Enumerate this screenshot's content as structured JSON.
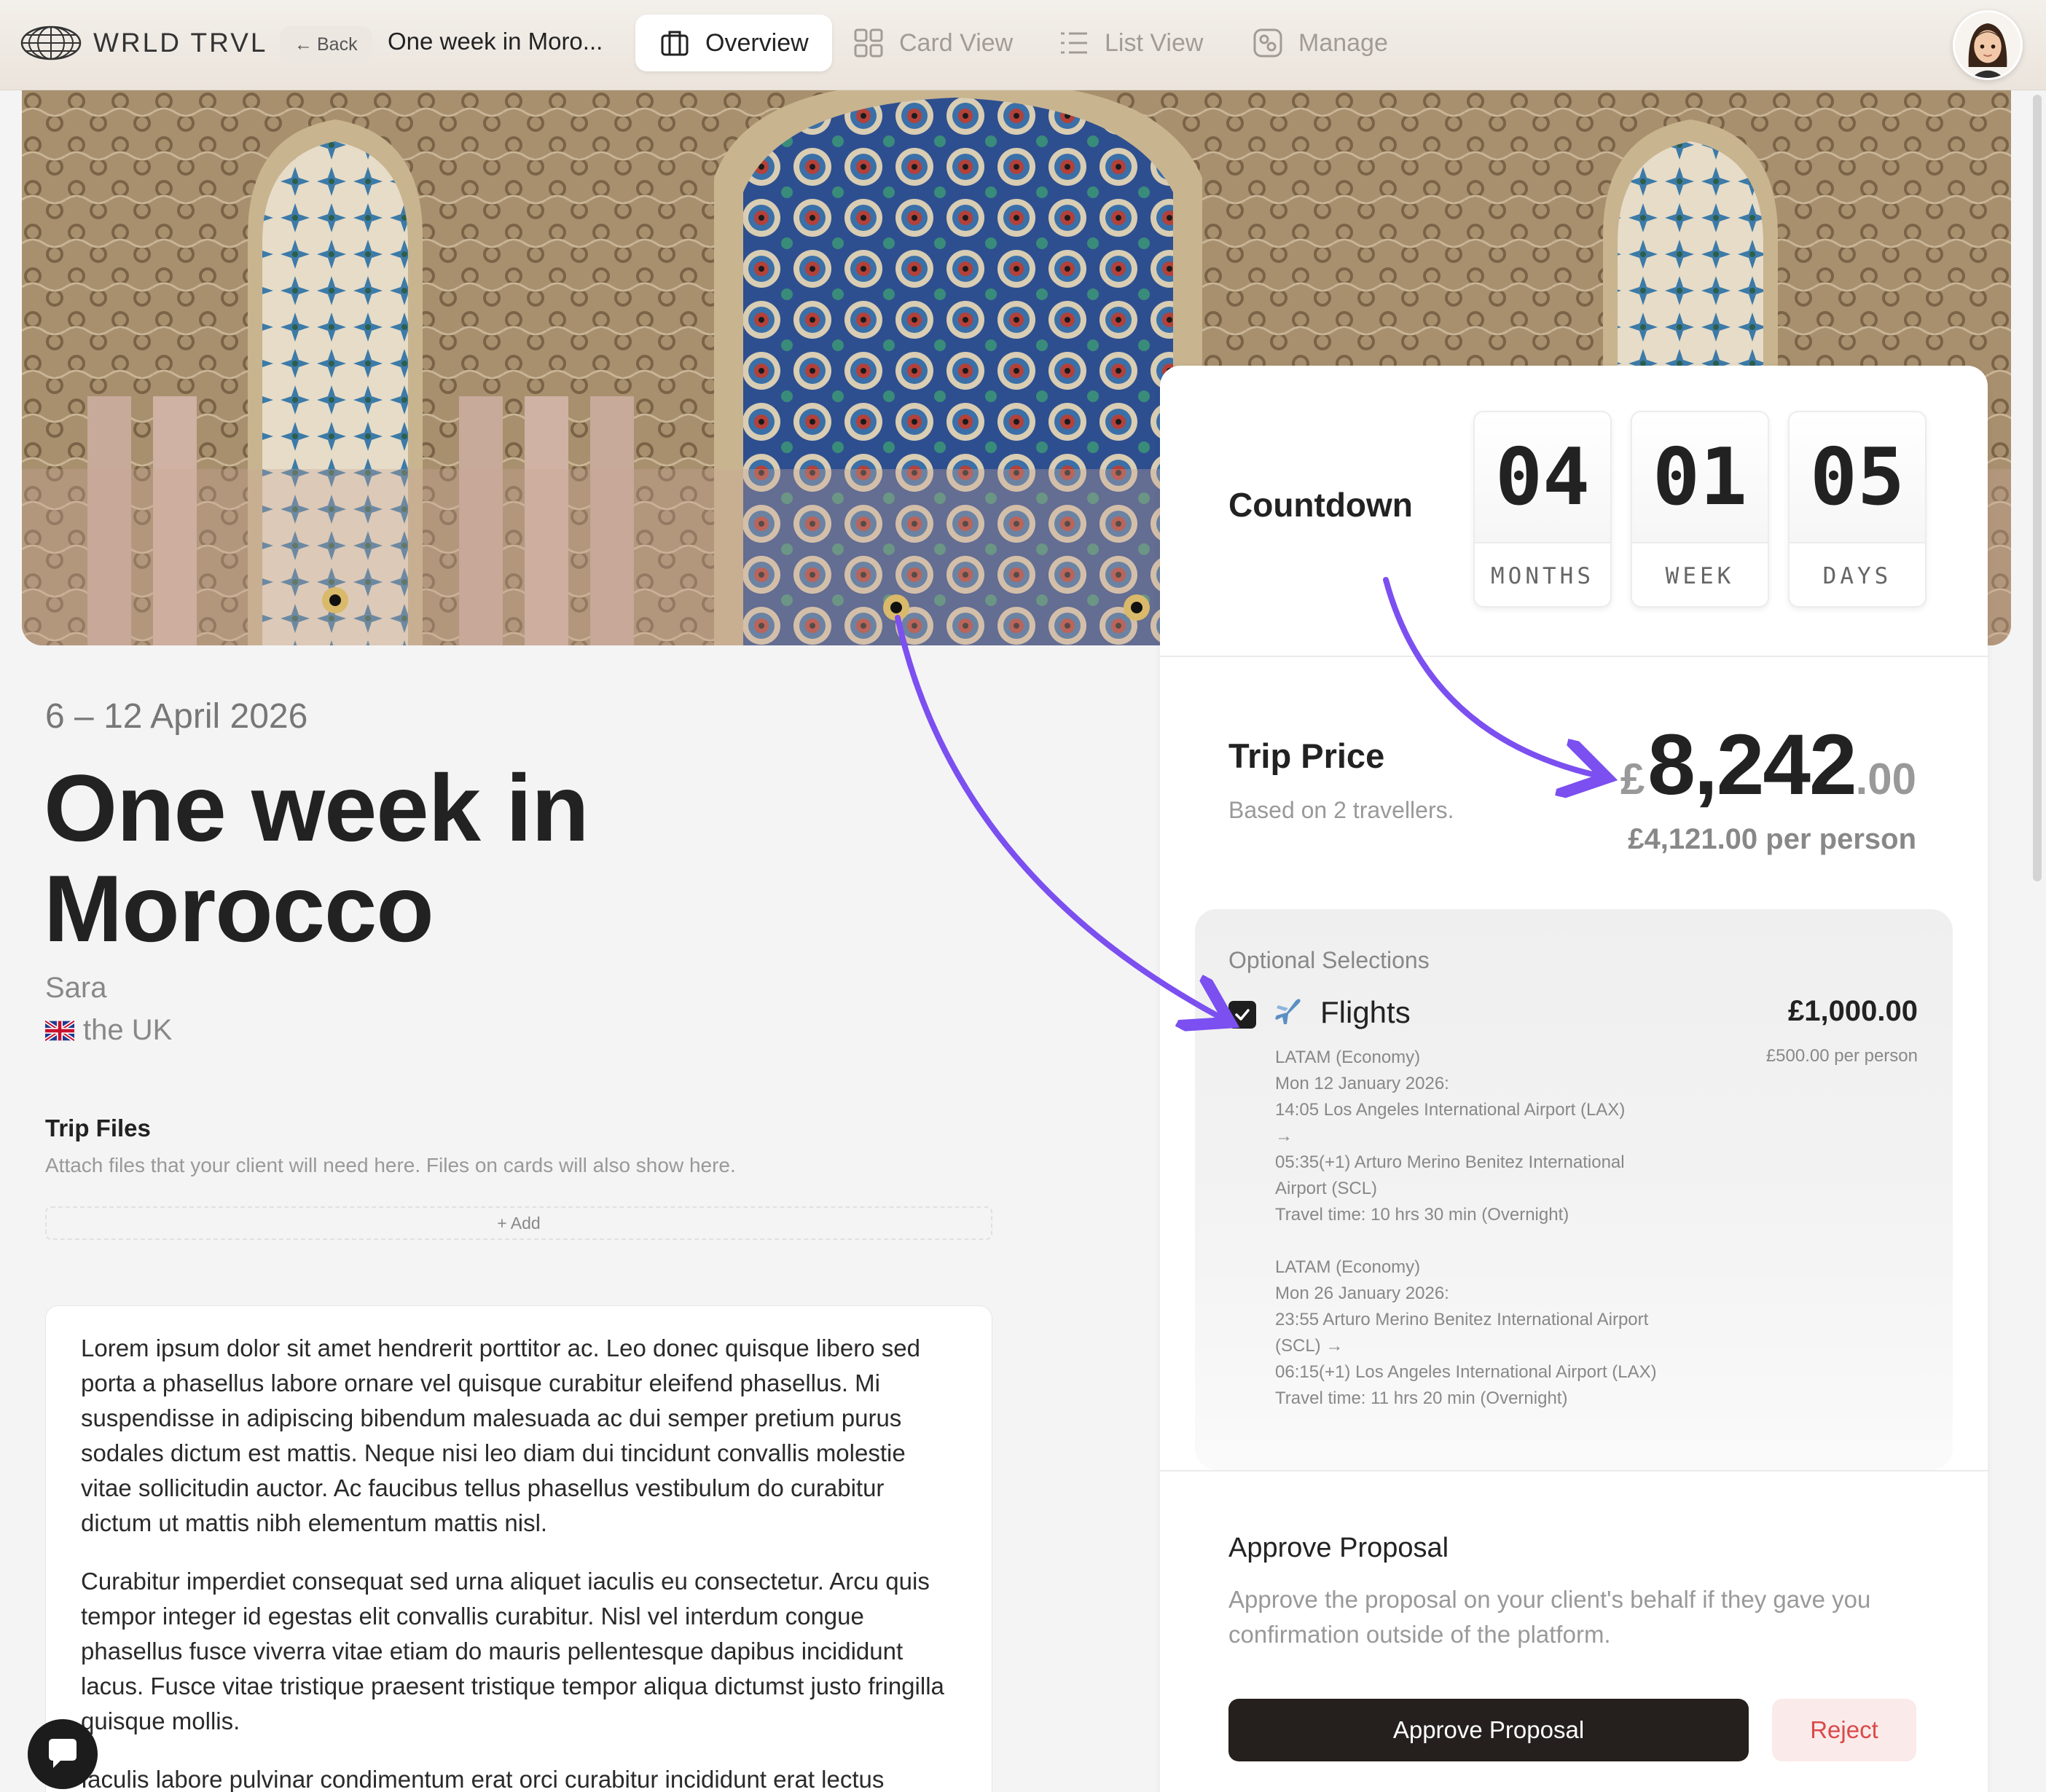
{
  "nav": {
    "logo_text": "WRLD TRVL",
    "back_label": "Back",
    "trip_name": "One week in Moro...",
    "tabs": [
      {
        "label": "Overview",
        "icon": "suitcase-icon",
        "active": true
      },
      {
        "label": "Card View",
        "icon": "grid-icon",
        "active": false
      },
      {
        "label": "List View",
        "icon": "list-icon",
        "active": false
      },
      {
        "label": "Manage",
        "icon": "manage-icon",
        "active": false
      }
    ]
  },
  "trip": {
    "dates": "6 – 12 April 2026",
    "title_line1": "One week in",
    "title_line2": "Morocco",
    "client": "Sara",
    "country": "the UK"
  },
  "files": {
    "title": "Trip Files",
    "description": "Attach files that your client will need here. Files on cards will also show here.",
    "add_label": "+ Add"
  },
  "description": {
    "paragraphs": [
      "Lorem ipsum dolor sit amet hendrerit porttitor ac. Leo donec quisque libero sed porta a phasellus labore ornare vel quisque curabitur eleifend phasellus. Mi suspendisse in adipiscing bibendum malesuada ac dui semper pretium purus sodales dictum est mattis. Neque nisi leo diam dui tincidunt convallis molestie vitae sollicitudin auctor. Ac faucibus tellus phasellus vestibulum do curabitur dictum ut mattis nibh elementum mattis nisl.",
      "Curabitur imperdiet consequat sed urna aliquet iaculis eu consectetur. Arcu quis tempor integer id egestas elit convallis curabitur. Nisl vel interdum congue phasellus fusce viverra vitae etiam do mauris pellentesque dapibus incididunt lacus. Fusce vitae tristique praesent tristique tempor aliqua dictumst justo fringilla quisque mollis.",
      "Iaculis labore pulvinar condimentum erat orci curabitur incididunt erat lectus"
    ]
  },
  "countdown": {
    "label": "Countdown",
    "months": "04",
    "months_unit": "MONTHS",
    "week": "01",
    "week_unit": "WEEK",
    "days": "05",
    "days_unit": "DAYS"
  },
  "price": {
    "label": "Trip Price",
    "sub": "Based on 2 travellers.",
    "currency": "£",
    "amount": "8,242",
    "decimals": ".00",
    "per_person": "£4,121.00 per person"
  },
  "optional": {
    "title": "Optional Selections",
    "item": {
      "name": "Flights",
      "checked": true,
      "price": "£1,000.00",
      "per_person": "£500.00 per person",
      "outbound": "LATAM (Economy)\nMon 12 January 2026:\n14:05 Los Angeles International Airport (LAX)\n→\n05:35(+1) Arturo Merino Benitez International Airport (SCL)\nTravel time: 10 hrs 30 min (Overnight)",
      "inbound": "LATAM (Economy)\nMon 26 January 2026:\n23:55 Arturo Merino Benitez International Airport (SCL) →\n06:15(+1) Los Angeles International Airport (LAX)\nTravel time: 11 hrs 20 min (Overnight)"
    }
  },
  "approve": {
    "title": "Approve Proposal",
    "description": "Approve the proposal on your client's behalf if they gave you confirmation outside of the platform.",
    "approve_label": "Approve Proposal",
    "reject_label": "Reject"
  },
  "colors": {
    "accent_arrow": "#7b4ff0",
    "approve_bg": "#25201d",
    "reject_text": "#d94a4a",
    "reject_bg": "#fbeaea"
  }
}
